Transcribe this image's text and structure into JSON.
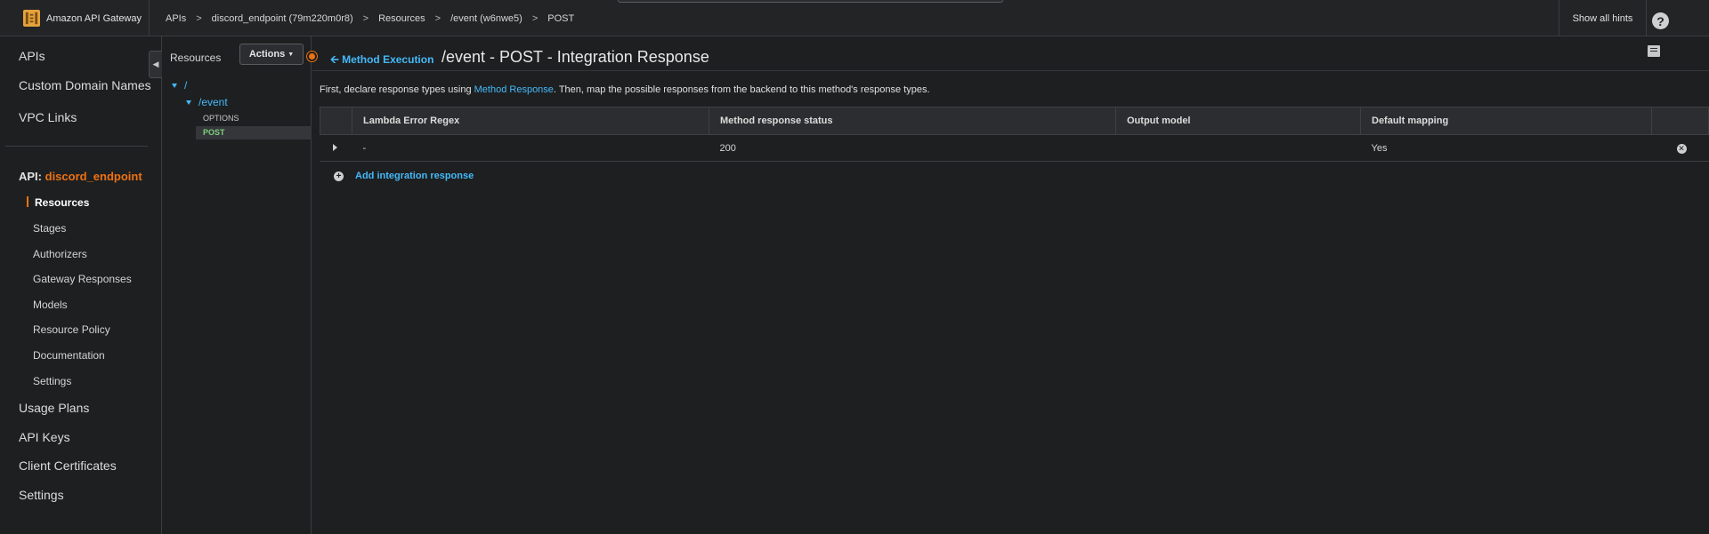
{
  "topbar": {
    "brand": "Amazon API Gateway",
    "breadcrumbs": [
      "APIs",
      "discord_endpoint (79m220m0r8)",
      "Resources",
      "/event (w6nwe5)",
      "POST"
    ],
    "separator": ">",
    "show_hints": "Show all hints",
    "help_glyph": "?"
  },
  "sidebar": {
    "top_items": [
      "APIs",
      "Custom Domain Names",
      "VPC Links"
    ],
    "api_prefix": "API:",
    "api_name": "discord_endpoint",
    "sub_items": [
      "Resources",
      "Stages",
      "Authorizers",
      "Gateway Responses",
      "Models",
      "Resource Policy",
      "Documentation",
      "Settings"
    ],
    "bottom_items": [
      "Usage Plans",
      "API Keys",
      "Client Certificates",
      "Settings"
    ]
  },
  "resources": {
    "title": "Resources",
    "actions_label": "Actions",
    "root": "/",
    "child": "/event",
    "methods": [
      "OPTIONS",
      "POST"
    ]
  },
  "main": {
    "back_label": "Method Execution",
    "title": "/event - POST - Integration Response",
    "intro_before": "First, declare response types using ",
    "intro_link": "Method Response",
    "intro_after": ". Then, map the possible responses from the backend to this method's response types.",
    "table": {
      "headers": [
        "Lambda Error Regex",
        "Method response status",
        "Output model",
        "Default mapping"
      ],
      "rows": [
        {
          "regex": "-",
          "status": "200",
          "model": "",
          "default": "Yes"
        }
      ]
    },
    "add_label": "Add integration response"
  },
  "colors": {
    "accent": "#ec7211",
    "link": "#44b9f8",
    "background": "#1e1f21"
  }
}
